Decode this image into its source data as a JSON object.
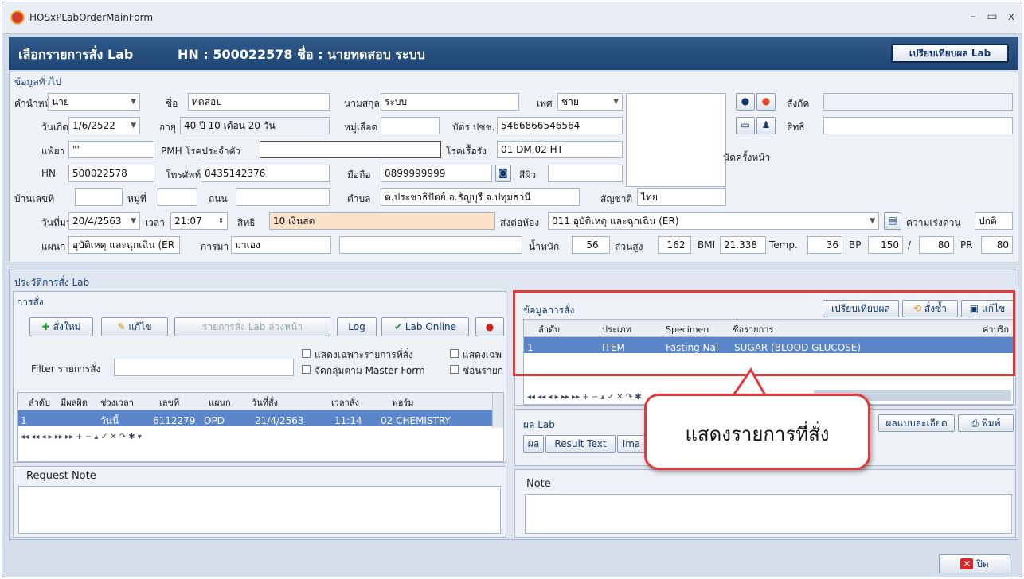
{
  "window": {
    "title": "HOSxPLabOrderMainForm",
    "min": "–",
    "max": "▭",
    "close": "x"
  },
  "header": {
    "title": "เลือกรายการสั่ง Lab",
    "patient": "HN : 500022578 ชื่อ : นายทดสอบ ระบบ",
    "compare_btn": "เปรียบเทียบผล Lab"
  },
  "general": {
    "section": "ข้อมูลทั่วไป",
    "prefix_label": "คำนำหน้า",
    "prefix": "นาย",
    "name_label": "ชื่อ",
    "name": "ทดสอบ",
    "surname_label": "นามสกุล",
    "surname": "ระบบ",
    "sex_label": "เพศ",
    "sex": "ชาย",
    "affiliation_label": "สังกัด",
    "affiliation": "",
    "dob_label": "วันเกิด",
    "dob": "1/6/2522",
    "age_label": "อายุ",
    "age": "40 ปี 10 เดือน 20 วัน",
    "blood_label": "หมู่เลือด",
    "blood": "",
    "cid_label": "บัตร ปชช.",
    "cid": "5466866546564",
    "right_label": "สิทธิ",
    "right": "",
    "allergy_label": "แพ้ยา",
    "allergy": "\"\"",
    "pmh_label": "PMH โรคประจำตัว",
    "pmh": "",
    "chronic_label": "โรคเรื้อรัง",
    "chronic": "01 DM,02 HT",
    "next_appt": "นัดครั้งหน้า",
    "hn_label": "HN",
    "hn": "500022578",
    "phone_label": "โทรศัพท์",
    "phone": "0435142376",
    "mobile_label": "มือถือ",
    "mobile": "0899999999",
    "skin_label": "สีผิว",
    "skin": "",
    "house_label": "บ้านเลขที่",
    "house": "",
    "moo_label": "หมู่ที่",
    "moo": "",
    "road_label": "ถนน",
    "road": "",
    "tambon_label": "ตำบล",
    "tambon": "ต.ประชาธิปัตย์ อ.ธัญบุรี จ.ปทุมธานี",
    "nation_label": "สัญชาติ",
    "nation": "ไทย",
    "visit_label": "วันที่มา",
    "visit": "20/4/2563",
    "time_label": "เวลา",
    "time": "21:07",
    "visit_right_label": "สิทธิ",
    "visit_right": "10 เงินสด",
    "send_label": "ส่งต่อห้อง",
    "send": "011 อุบัติเหตุ และฉุกเฉิน (ER)",
    "urgency_label": "ความเร่งด่วน",
    "urgency": "ปกติ",
    "dept_label": "แผนก",
    "dept": "อุบัติเหตุ และฉุกเฉิน (ER",
    "arrive_label": "การมา",
    "arrive": "มาเอง",
    "arrive2": "",
    "weight_label": "น้ำหนัก",
    "weight": "56",
    "height_label": "ส่วนสูง",
    "height": "162",
    "bmi_label": "BMI",
    "bmi": "21.338",
    "temp_label": "Temp.",
    "temp": "36",
    "bp_label": "BP",
    "bp_sys": "150",
    "bp_slash": "/",
    "bp_dia": "80",
    "pr_label": "PR",
    "pr": "80"
  },
  "history": {
    "section": "ประวัติการสั่ง Lab",
    "order_section": "การสั่ง",
    "new": "สั่งใหม่",
    "edit": "แก้ไข",
    "preorder": "รายการสั่ง Lab ล่วงหน้า",
    "log": "Log",
    "online": "Lab Online",
    "only_ordered": "แสดงเฉพาะรายการที่สั่ง",
    "show_partial": "แสดงเฉพ",
    "group_master": "จัดกลุ่มตาม Master Form",
    "hide_partial": "ซ่อนรายก",
    "filter_label": "Filter รายการสั่ง",
    "filter": "",
    "columns": [
      "ลำดับ",
      "มีผลผิด",
      "ช่วงเวลา",
      "เลขที่",
      "แผนก",
      "วันที่สั่ง",
      "เวลาสั่ง",
      "ฟอร์ม"
    ],
    "row": [
      "1",
      "",
      "วันนี้",
      "6112279",
      "OPD",
      "21/4/2563",
      "11:14",
      "02 CHEMISTRY"
    ],
    "note_label": "Request Note"
  },
  "order_info": {
    "section": "ข้อมูลการสั่ง",
    "compare": "เปรียบเทียบผล",
    "reorder": "สั่งซ้ำ",
    "edit": "แก้ไข",
    "columns": [
      "ลำดับ",
      "ประเภท",
      "Specimen",
      "ชื่อรายการ",
      "ค่าบริก"
    ],
    "row": [
      "1",
      "ITEM",
      "Fasting Nal",
      "SUGAR (BLOOD GLUCOSE)",
      ""
    ]
  },
  "result": {
    "section": "ผล Lab",
    "detail": "ผลแบบละเอียด",
    "print": "พิมพ์",
    "tabs": [
      "ผล",
      "Result Text",
      "Ima"
    ],
    "note_label": "Note"
  },
  "callout": {
    "text": "แสดงรายการที่สั่ง"
  },
  "footer": {
    "close": "ปิด"
  },
  "colors": {
    "header": "#2f5a8a",
    "highlight": "#e0393e",
    "selected_row": "#5b86c9"
  }
}
